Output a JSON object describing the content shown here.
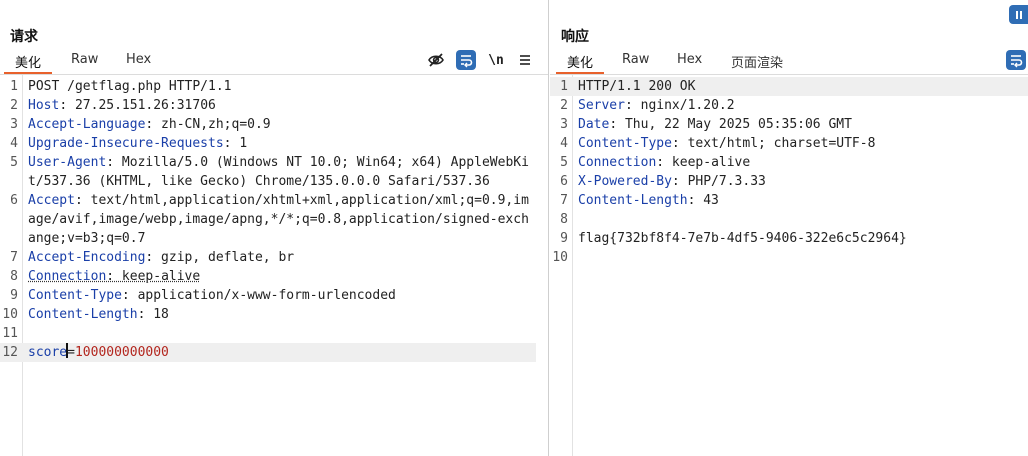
{
  "request": {
    "title": "请求",
    "tabs": [
      "美化",
      "Raw",
      "Hex"
    ],
    "active_tab": "美化",
    "tools": [
      "eye-off-icon",
      "wrap-icon",
      "newline-icon",
      "menu-icon"
    ],
    "newline_label": "\\n",
    "lines": [
      {
        "n": "1",
        "plain": "POST /getflag.php HTTP/1.1"
      },
      {
        "n": "2",
        "name": "Host",
        "value": " 27.25.151.26:31706"
      },
      {
        "n": "3",
        "name": "Accept-Language",
        "value": " zh-CN,zh;q=0.9"
      },
      {
        "n": "4",
        "name": "Upgrade-Insecure-Requests",
        "value": " 1"
      },
      {
        "n": "5",
        "name": "User-Agent",
        "value": " Mozilla/5.0 (Windows NT 10.0; Win64; x64) AppleWebKit/537.36 (KHTML, like Gecko) Chrome/135.0.0.0 Safari/537.36"
      },
      {
        "n": "6",
        "name": "Accept",
        "value": " text/html,application/xhtml+xml,application/xml;q=0.9,image/avif,image/webp,image/apng,*/*;q=0.8,application/signed-exchange;v=b3;q=0.7"
      },
      {
        "n": "7",
        "name": "Accept-Encoding",
        "value": " gzip, deflate, br"
      },
      {
        "n": "8",
        "name": "Connection",
        "value": " keep-alive"
      },
      {
        "n": "9",
        "name": "Content-Type",
        "value": " application/x-www-form-urlencoded"
      },
      {
        "n": "10",
        "name": "Content-Length",
        "value": " 18"
      },
      {
        "n": "11",
        "plain": ""
      },
      {
        "n": "12",
        "param_name": "score",
        "param_eq": "=",
        "param_value": "100000000000"
      }
    ]
  },
  "response": {
    "title": "响应",
    "tabs": [
      "美化",
      "Raw",
      "Hex",
      "页面渲染"
    ],
    "active_tab": "美化",
    "lines": [
      {
        "n": "1",
        "plain": "HTTP/1.1 200 OK"
      },
      {
        "n": "2",
        "name": "Server",
        "value": " nginx/1.20.2"
      },
      {
        "n": "3",
        "name": "Date",
        "value": " Thu, 22 May 2025 05:35:06 GMT"
      },
      {
        "n": "4",
        "name": "Content-Type",
        "value": " text/html; charset=UTF-8"
      },
      {
        "n": "5",
        "name": "Connection",
        "value": " keep-alive"
      },
      {
        "n": "6",
        "name": "X-Powered-By",
        "value": " PHP/7.3.33"
      },
      {
        "n": "7",
        "name": "Content-Length",
        "value": " 43"
      },
      {
        "n": "8",
        "plain": ""
      },
      {
        "n": "9",
        "plain": "flag{732bf8f4-7e7b-4df5-9406-322e6c5c2964}"
      },
      {
        "n": "10",
        "plain": ""
      }
    ]
  },
  "colors": {
    "accent": "#e8612c",
    "header_name": "#1a3fa8",
    "param_value": "#b3261e",
    "button_blue": "#2f6db5"
  }
}
